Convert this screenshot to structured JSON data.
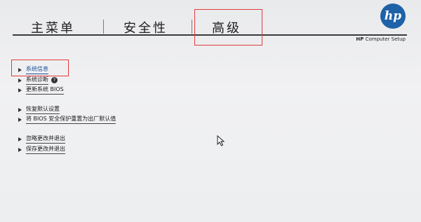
{
  "tabs": [
    "主菜单",
    "安全性",
    "高级"
  ],
  "logo_text": "hp",
  "subtitle": {
    "brand": "HP",
    "rest": " Computer Setup"
  },
  "menu": [
    {
      "label": "系统信息",
      "selected": true
    },
    {
      "label": "系统诊断",
      "help": "?"
    },
    {
      "label": "更新系统 BIOS"
    },
    {
      "label": "恢复默认设置"
    },
    {
      "label": "将 BIOS 安全保护重置为出厂默认值"
    },
    {
      "label": "忽略更改并退出"
    },
    {
      "label": "保存更改并退出"
    }
  ],
  "colors": {
    "accent": "#1d4f9a",
    "highlight": "#e23b3b",
    "logo": "#1e62a8"
  },
  "icons": [
    "hp-logo-icon",
    "arrow-right-icon",
    "help-icon",
    "mouse-cursor-icon"
  ]
}
